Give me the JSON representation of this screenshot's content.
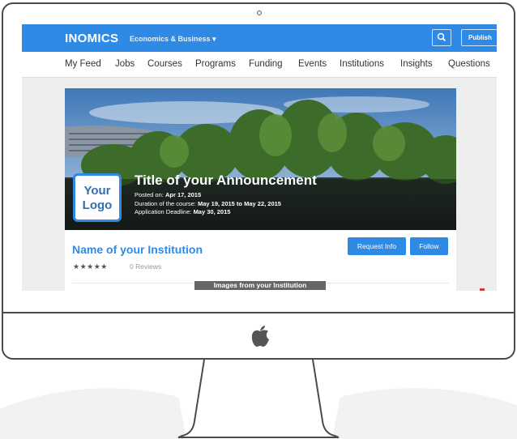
{
  "topbar": {
    "brand": "INOMICS",
    "brand_sub": "Economics & Business ▾",
    "publish_label": "Publish"
  },
  "nav": {
    "items": [
      "My Feed",
      "Jobs",
      "Courses",
      "Programs",
      "Funding",
      "Events",
      "Institutions",
      "Insights",
      "Questions"
    ]
  },
  "announcement": {
    "logo_line1": "Your",
    "logo_line2": "Logo",
    "title": "Title of your Announcement",
    "posted_label": "Posted on:",
    "posted_value": "Apr 17, 2015",
    "duration_label": "Duration of the course:",
    "duration_value": "May 19, 2015 to May 22, 2015",
    "deadline_label": "Application Deadline:",
    "deadline_value": "May 30, 2015"
  },
  "institution": {
    "name": "Name of your Institution",
    "stars": "★★★★★",
    "reviews": "0 Reviews",
    "request_info_label": "Request Info",
    "follow_label": "Follow"
  },
  "images_label": "Images from your Institution",
  "colors": {
    "brand_blue": "#2f8ae5",
    "frame": "#4a4a4a"
  }
}
